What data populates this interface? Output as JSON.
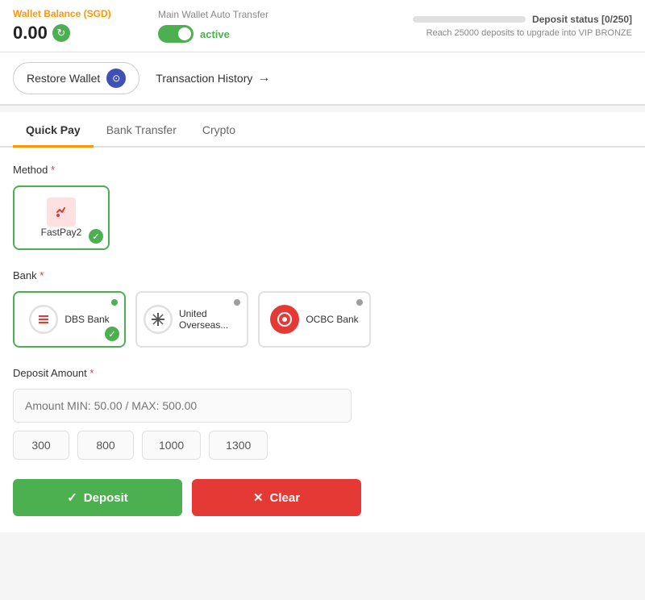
{
  "topBar": {
    "walletLabel": "Wallet Balance",
    "walletCurrency": "(SGD)",
    "walletAmount": "0.00",
    "autoTransferLabel": "Main Wallet Auto Transfer",
    "activeText": "active",
    "depositStatusText": "Deposit status [0/250]",
    "depositUpgradeText": "Reach 25000 deposits to upgrade into VIP BRONZE",
    "progressPercent": 0
  },
  "actions": {
    "restoreWallet": "Restore Wallet",
    "transactionHistory": "Transaction History"
  },
  "tabs": [
    {
      "label": "Quick Pay",
      "active": true
    },
    {
      "label": "Bank Transfer",
      "active": false
    },
    {
      "label": "Crypto",
      "active": false
    }
  ],
  "form": {
    "methodLabel": "Method",
    "required": "*",
    "methods": [
      {
        "name": "FastPay2",
        "selected": true
      }
    ],
    "bankLabel": "Bank",
    "banks": [
      {
        "name": "DBS Bank",
        "selected": true,
        "status": "green"
      },
      {
        "name": "United Overseas...",
        "selected": false,
        "status": "gray"
      },
      {
        "name": "OCBC Bank",
        "selected": false,
        "status": "gray"
      }
    ],
    "depositAmountLabel": "Deposit Amount",
    "amountPlaceholder": "Amount MIN: 50.00 / MAX: 500.00",
    "quickAmounts": [
      "300",
      "800",
      "1000",
      "1300"
    ],
    "depositBtn": "Deposit",
    "clearBtn": "Clear"
  }
}
